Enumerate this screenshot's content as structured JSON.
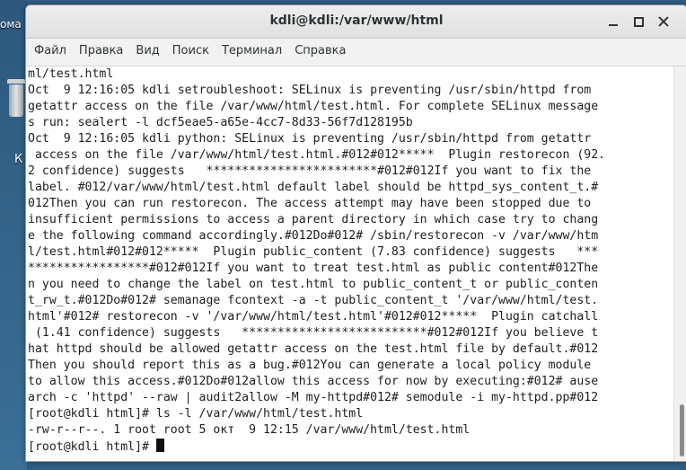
{
  "desktop": {
    "left_label": "ома",
    "letter": "К"
  },
  "window": {
    "title": "kdli@kdli:/var/www/html"
  },
  "menu": [
    "Файл",
    "Правка",
    "Вид",
    "Поиск",
    "Терминал",
    "Справка"
  ],
  "terminal": {
    "lines": [
      "ml/test.html",
      "Oct  9 12:16:05 kdli setroubleshoot: SELinux is preventing /usr/sbin/httpd from",
      "getattr access on the file /var/www/html/test.html. For complete SELinux message",
      "s run: sealert -l dcf5eae5-a65e-4cc7-8d33-56f7d128195b",
      "Oct  9 12:16:05 kdli python: SELinux is preventing /usr/sbin/httpd from getattr",
      " access on the file /var/www/html/test.html.#012#012*****  Plugin restorecon (92.",
      "2 confidence) suggests   ************************#012#012If you want to fix the",
      "label. #012/var/www/html/test.html default label should be httpd_sys_content_t.#",
      "012Then you can run restorecon. The access attempt may have been stopped due to",
      "insufficient permissions to access a parent directory in which case try to chang",
      "e the following command accordingly.#012Do#012# /sbin/restorecon -v /var/www/htm",
      "l/test.html#012#012*****  Plugin public_content (7.83 confidence) suggests   ***",
      "*****************#012#012If you want to treat test.html as public content#012The",
      "n you need to change the label on test.html to public_content_t or public_conten",
      "t_rw_t.#012Do#012# semanage fcontext -a -t public_content_t '/var/www/html/test.",
      "html'#012# restorecon -v '/var/www/html/test.html'#012#012*****  Plugin catchall",
      " (1.41 confidence) suggests   **************************#012#012If you believe t",
      "hat httpd should be allowed getattr access on the test.html file by default.#012",
      "Then you should report this as a bug.#012You can generate a local policy module",
      "to allow this access.#012Do#012allow this access for now by executing:#012# ause",
      "arch -c 'httpd' --raw | audit2allow -M my-httpd#012# semodule -i my-httpd.pp#012",
      "[root@kdli html]# ls -l /var/www/html/test.html",
      "-rw-r--r--. 1 root root 5 окт  9 12:15 /var/www/html/test.html"
    ],
    "prompt": "[root@kdli html]# "
  }
}
